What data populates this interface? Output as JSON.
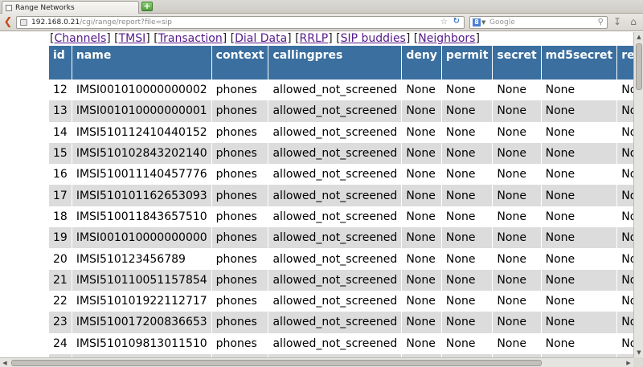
{
  "browser": {
    "tab_title": "Range Networks",
    "new_tab_label": "+",
    "url_host": "192.168.0.21",
    "url_path": "/cgi/range/report?file=sip",
    "search_placeholder": "Google",
    "search_engine_letter": "8"
  },
  "nav_links": [
    {
      "label": "Channels"
    },
    {
      "label": "TMSI"
    },
    {
      "label": "Transaction"
    },
    {
      "label": "Dial Data"
    },
    {
      "label": "RRLP"
    },
    {
      "label": "SIP buddies"
    },
    {
      "label": "Neighbors"
    }
  ],
  "table": {
    "headers": [
      "id",
      "name",
      "context",
      "callingpres",
      "deny",
      "permit",
      "secret",
      "md5secret",
      "remo"
    ],
    "rows": [
      [
        "12",
        "IMSI001010000000002",
        "phones",
        "allowed_not_screened",
        "None",
        "None",
        "None",
        "None",
        "None"
      ],
      [
        "13",
        "IMSI001010000000001",
        "phones",
        "allowed_not_screened",
        "None",
        "None",
        "None",
        "None",
        "None"
      ],
      [
        "14",
        "IMSI510112410440152",
        "phones",
        "allowed_not_screened",
        "None",
        "None",
        "None",
        "None",
        "None"
      ],
      [
        "15",
        "IMSI510102843202140",
        "phones",
        "allowed_not_screened",
        "None",
        "None",
        "None",
        "None",
        "None"
      ],
      [
        "16",
        "IMSI510011140457776",
        "phones",
        "allowed_not_screened",
        "None",
        "None",
        "None",
        "None",
        "None"
      ],
      [
        "17",
        "IMSI510101162653093",
        "phones",
        "allowed_not_screened",
        "None",
        "None",
        "None",
        "None",
        "None"
      ],
      [
        "18",
        "IMSI510011843657510",
        "phones",
        "allowed_not_screened",
        "None",
        "None",
        "None",
        "None",
        "None"
      ],
      [
        "19",
        "IMSI001010000000000",
        "phones",
        "allowed_not_screened",
        "None",
        "None",
        "None",
        "None",
        "None"
      ],
      [
        "20",
        "IMSI510123456789",
        "phones",
        "allowed_not_screened",
        "None",
        "None",
        "None",
        "None",
        "None"
      ],
      [
        "21",
        "IMSI510110051157854",
        "phones",
        "allowed_not_screened",
        "None",
        "None",
        "None",
        "None",
        "None"
      ],
      [
        "22",
        "IMSI510101922112717",
        "phones",
        "allowed_not_screened",
        "None",
        "None",
        "None",
        "None",
        "None"
      ],
      [
        "23",
        "IMSI510017200836653",
        "phones",
        "allowed_not_screened",
        "None",
        "None",
        "None",
        "None",
        "None"
      ],
      [
        "24",
        "IMSI510109813011510",
        "phones",
        "allowed_not_screened",
        "None",
        "None",
        "None",
        "None",
        "None"
      ],
      [
        "",
        "",
        "",
        "",
        "",
        "",
        "",
        "",
        ""
      ]
    ]
  },
  "colors": {
    "header_bg": "#3a6f9f",
    "stripe_bg": "#dcdcdc",
    "link_visited": "#551a8b"
  }
}
